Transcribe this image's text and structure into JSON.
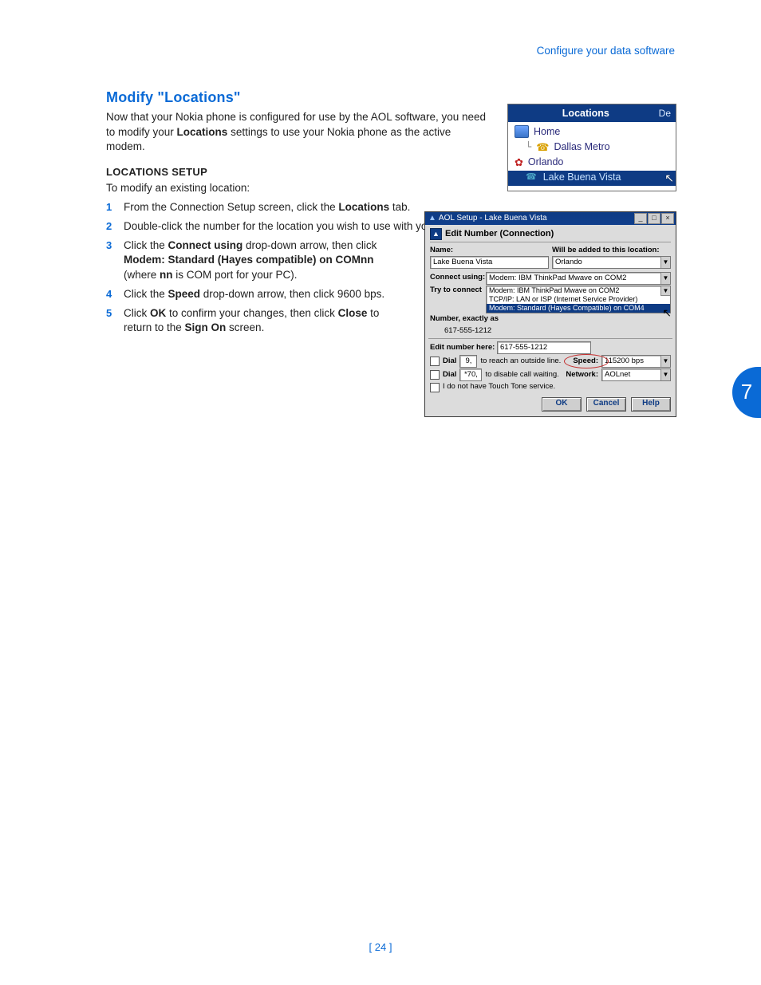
{
  "header_link": "Configure your data software",
  "title": "Modify \"Locations\"",
  "intro_parts": {
    "a": "Now that your Nokia phone is configured for use by the AOL software, you need to modify your ",
    "b": "Locations",
    "c": " settings to use your Nokia phone as the active modem."
  },
  "sub_title": "LOCATIONS SETUP",
  "sub_lead": "To modify an existing location:",
  "steps": {
    "s1": {
      "a": "From the Connection Setup screen, click the ",
      "b": "Locations",
      "c": " tab."
    },
    "s2": "Double-click the number for the location you wish to use with your Nokia phone.",
    "s3": {
      "a": "Click the ",
      "b": "Connect using",
      "c": " drop-down arrow, then click ",
      "d": "Modem: Standard (Hayes compatible) on COMnn",
      "e": " (where ",
      "f": "nn",
      "g": " is COM port for your PC)."
    },
    "s4": {
      "a": "Click the ",
      "b": "Speed",
      "c": " drop-down arrow, then click 9600 bps."
    },
    "s5": {
      "a": "Click ",
      "b": "OK",
      "c": " to confirm your changes, then click ",
      "d": "Close",
      "e": " to return to the ",
      "f": "Sign On",
      "g": " screen."
    }
  },
  "locations_panel": {
    "title": "Locations",
    "corner": "De",
    "items": [
      "Home",
      "Dallas Metro",
      "Orlando",
      "Lake Buena Vista"
    ]
  },
  "dialog": {
    "title": "AOL Setup - Lake Buena Vista",
    "heading": "Edit Number (Connection)",
    "name_label": "Name:",
    "name_value": "Lake Buena Vista",
    "added_label": "Will be added to this location:",
    "added_value": "Orlando",
    "connect_label": "Connect using:",
    "connect_value": "Modem: IBM ThinkPad Mwave on COM2",
    "try_label": "Try to connect",
    "try_options": [
      "Modem: IBM ThinkPad Mwave on COM2",
      "TCP/IP:  LAN or ISP (Internet Service Provider)",
      "Modem: Standard (Hayes Compatible) on COM4"
    ],
    "number_label": "Number, exactly as",
    "number_value": "617-555-1212",
    "edit_label": "Edit number here:",
    "edit_value": "617-555-1212",
    "dial1_prefix": "Dial",
    "dial1_val": "9,",
    "dial1_suffix": "to reach an outside line.",
    "dial2_prefix": "Dial",
    "dial2_val": "*70,",
    "dial2_suffix": "to disable call waiting.",
    "touchtone": "I do not have Touch Tone service.",
    "speed_label": "Speed:",
    "speed_value": "115200 bps",
    "network_label": "Network:",
    "network_value": "AOLnet",
    "buttons": {
      "ok": "OK",
      "cancel": "Cancel",
      "help": "Help"
    }
  },
  "chapter": "7",
  "page_number": "[ 24 ]"
}
